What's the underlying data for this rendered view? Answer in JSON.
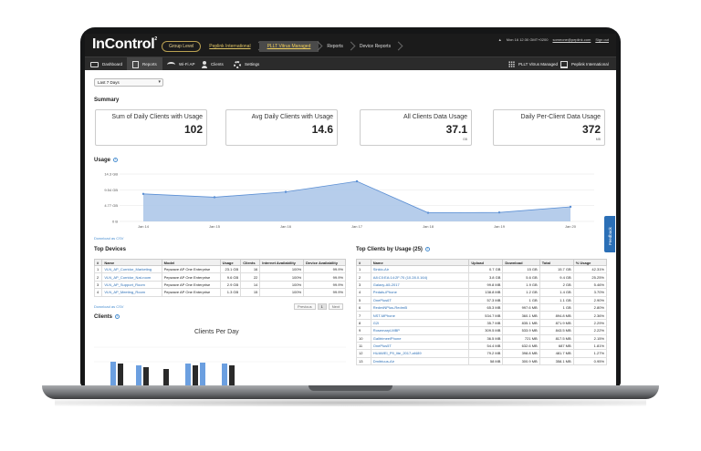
{
  "app": {
    "logo": "InControl",
    "logo_mark": "2"
  },
  "breadcrumbs": [
    {
      "label": "Group Level"
    },
    {
      "label": "Peplink International"
    },
    {
      "label": "PLLT Vitrus Managed"
    },
    {
      "label": "Reports"
    },
    {
      "label": "Device Reports"
    }
  ],
  "user": {
    "time": "Mon 16 12:30 GMT+0200",
    "email": "someone@peplink.com",
    "logout": "Sign out"
  },
  "nav": {
    "items": [
      {
        "label": "Dashboard",
        "icon": "monitor-icon"
      },
      {
        "label": "Reports",
        "icon": "report-icon"
      },
      {
        "label": "Wi-Fi AP",
        "icon": "wifi-icon"
      },
      {
        "label": "Clients",
        "icon": "person-icon"
      },
      {
        "label": "Settings",
        "icon": "gear-icon"
      }
    ],
    "right": [
      {
        "label": "PLLT Vitrus Managed",
        "icon": "grid-icon"
      },
      {
        "label": "Peplink International",
        "icon": "building-icon"
      }
    ]
  },
  "filter": {
    "period": "Last 7 Days"
  },
  "summary": {
    "title": "Summary",
    "cards": [
      {
        "label": "Sum of Daily Clients with Usage",
        "value": "102",
        "unit": ""
      },
      {
        "label": "Avg Daily Clients with Usage",
        "value": "14.6",
        "unit": ""
      },
      {
        "label": "All Clients Data Usage",
        "value": "37.1",
        "unit": "GB"
      },
      {
        "label": "Daily Per-Client Data Usage",
        "value": "372",
        "unit": "MB"
      }
    ]
  },
  "usage": {
    "title": "Usage",
    "csv_label": "Download as CSV",
    "y_ticks": [
      "14.3 GB",
      "9.54 GB",
      "4.77 GB",
      "0 B"
    ],
    "x_ticks": [
      "Jan 14",
      "Jan 15",
      "Jan 16",
      "Jan 17",
      "Jan 18",
      "Jan 19",
      "Jan 20"
    ],
    "values_gb": [
      8.3,
      7.3,
      8.9,
      12.1,
      2.6,
      2.7,
      4.4
    ],
    "ylim_gb": [
      0,
      14.3
    ],
    "color": "#a9c4e8",
    "line_color": "#5b8fd4"
  },
  "top_devices": {
    "title": "Top Devices",
    "headers": [
      "#",
      "Name",
      "Model",
      "Usage",
      "Clients",
      "Internet Availability",
      "Device Availability"
    ],
    "rows": [
      [
        "1",
        "VLN_AP_Corridor_Marketing",
        "Pepwave AP One Enterprise",
        "23.1 GB",
        "16",
        "100%",
        "99.9%"
      ],
      [
        "2",
        "VLN_AP_Corridor_Nat-room",
        "Pepwave AP One Enterprise",
        "9.6 GB",
        "22",
        "100%",
        "99.9%"
      ],
      [
        "3",
        "VLN_AP_Support_Room",
        "Pepwave AP One Enterprise",
        "2.9 GB",
        "14",
        "100%",
        "99.9%"
      ],
      [
        "4",
        "VLN_AP_Meeting_Room",
        "Pepwave AP One Enterprise",
        "1.3 GB",
        "15",
        "100%",
        "99.9%"
      ]
    ],
    "csv_label": "Download as CSV",
    "pager": {
      "prev": "Previous",
      "page": "1",
      "next": "Next"
    }
  },
  "clients": {
    "title": "Clients",
    "chart_title": "Clients Per Day"
  },
  "top_clients": {
    "title": "Top Clients by Usage (25)",
    "headers": [
      "#",
      "Name",
      "Upload",
      "Download",
      "Total",
      "% Usage"
    ],
    "rows": [
      [
        "1",
        "Sinkio-Air",
        "0.7 GB",
        "15 GB",
        "15.7 GB",
        "42.31%"
      ],
      [
        "2",
        "A8:C0:EA:14:2F:70 (10.28.0.164)",
        "3.8 GB",
        "5.6 GB",
        "9.4 GB",
        "25.25%"
      ],
      [
        "3",
        "Galaxy-A5-2017",
        "99.8 MB",
        "1.9 GB",
        "2 GB",
        "5.46%"
      ],
      [
        "4",
        "Pedals-iPhone",
        "138.8 MB",
        "1.2 GB",
        "1.4 GB",
        "3.70%"
      ],
      [
        "5",
        "OnePlus6T",
        "57.3 MB",
        "1 GB",
        "1.1 GB",
        "2.90%"
      ],
      [
        "6",
        "RedmiNPlus-Redmi5",
        "65.3 MB",
        "997.6 MB",
        "1 GB",
        "2.80%"
      ],
      [
        "7",
        "NST-MPhone",
        "534.7 MB",
        "360.1 MB",
        "894.8 MB",
        "2.36%"
      ],
      [
        "8",
        "G2I",
        "35.7 MB",
        "835.1 MB",
        "871.9 MB",
        "2.29%"
      ],
      [
        "9",
        "Rosemaryl-MBP",
        "309.5 MB",
        "533.9 MB",
        "843.5 MB",
        "2.22%"
      ],
      [
        "10",
        "GalitrimeeiPhone",
        "36.5 MB",
        "721 MB",
        "817.5 MB",
        "2.15%"
      ],
      [
        "11",
        "OnePlus5T",
        "54.4 MB",
        "632.6 MB",
        "687 MB",
        "1.81%"
      ],
      [
        "12",
        "HUAWEI_P9_lite_2017-af489",
        "79.2 MB",
        "398.8 MB",
        "481.7 MB",
        "1.27%"
      ],
      [
        "13",
        "Dmitriuus-Air",
        "58 MB",
        "300.9 MB",
        "358.1 MB",
        "0.95%"
      ]
    ]
  },
  "feedback": {
    "label": "Feedback"
  }
}
